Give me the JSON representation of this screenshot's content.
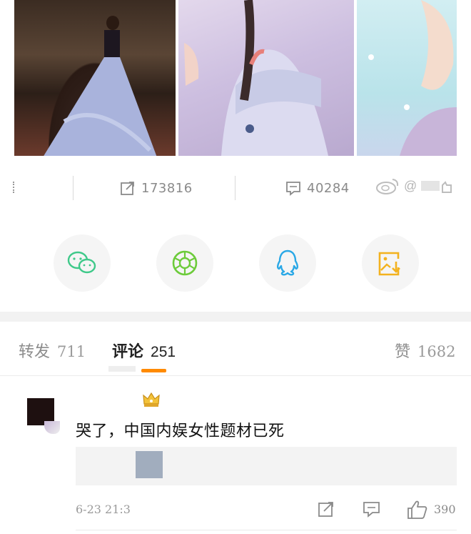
{
  "photos": [
    {
      "alt": ""
    },
    {
      "alt": ""
    },
    {
      "alt": ""
    }
  ],
  "stats": {
    "repost_count": "173816",
    "comment_count": "40284",
    "watermark_text": "@"
  },
  "share": {
    "items": [
      "wechat-icon",
      "moments-icon",
      "qq-icon",
      "save-image-icon"
    ]
  },
  "tabs": {
    "repost_label": "转发",
    "repost_count": "711",
    "comment_label": "评论",
    "comment_count": "251",
    "like_label": "赞",
    "like_count": "1682"
  },
  "comment": {
    "text": "哭了，中国内娱女性题材已死",
    "time": "6-23 21:3",
    "like_count": "390"
  },
  "colors": {
    "accent": "#ff8a00",
    "wechat": "#3fc98a",
    "moments": "#6ccb3a",
    "qq": "#2aa8e6",
    "save": "#f3b21f"
  }
}
